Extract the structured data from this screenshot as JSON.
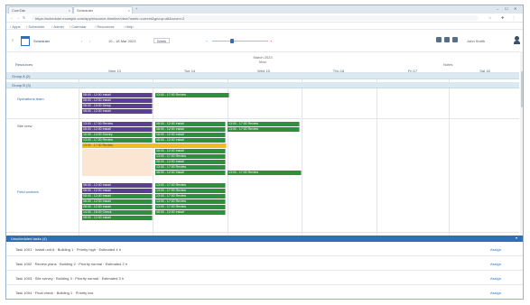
{
  "browser": {
    "tabs": [
      {
        "label": "ComTab"
      },
      {
        "label": "Scheduler"
      }
    ],
    "new_tab": "+",
    "url": "https://scheduler.example.com/app/resource-timeline/view?week=current&group=all&zoom=2",
    "bookmarks": [
      "Apps",
      "Scheduler",
      "Admin",
      "Calendar",
      "Resources",
      "Help"
    ],
    "window_controls": [
      "–",
      "☐",
      "✕"
    ]
  },
  "toolbar": {
    "app_title": "Scheduler",
    "prev": "‹",
    "next": "›",
    "date_range": "10 - 18 Mar 2023",
    "view": "Week",
    "zoom_minus": "−",
    "zoom_plus": "+",
    "user_name": "John Smith"
  },
  "header": {
    "resource_column": "Resources",
    "month": "March 2023",
    "weekday": "Mon",
    "columns": [
      "Mon 13",
      "Tue 14",
      "Wed 15",
      "Thu 16",
      "Fri 17",
      "Sat 18"
    ],
    "right_column": "Notes"
  },
  "groups": [
    {
      "label": "Group A (2)"
    },
    {
      "label": "Group B (3)"
    }
  ],
  "resources": [
    {
      "label": "Operations team"
    },
    {
      "label": "Site crew"
    },
    {
      "label": "Field workers"
    }
  ],
  "events": [
    {
      "text": "08:00 - 12:00 Install"
    },
    {
      "text": "08:00 - 12:00 Install"
    },
    {
      "text": "13:00 - 17:00 Review"
    },
    {
      "text": "08:00 - 10:00 Setup"
    },
    {
      "text": "08:00 - 12:00 Install"
    },
    {
      "text": "13:00 - 17:00 Review"
    },
    {
      "text": "08:00 - 12:00 Install"
    },
    {
      "text": "13:00 - 17:00 Review"
    },
    {
      "text": "08:00 - 12:00 Install"
    },
    {
      "text": "08:00 - 12:00 Install"
    },
    {
      "text": "13:00 - 17:00 Review"
    },
    {
      "text": "10:00 - 14:00 Survey"
    },
    {
      "text": "08:00 - 12:00 Install"
    },
    {
      "text": "13:00 - 17:00 Review"
    },
    {
      "text": "08:00 - 12:00 Install"
    },
    {
      "text": "13:00 - 17:00 Review"
    },
    {
      "text": "08:00 - 12:00 Install"
    },
    {
      "text": "13:00 - 17:00 Review"
    },
    {
      "text": "08:00 - 12:00 Install"
    },
    {
      "text": "13:00 - 17:00 Review"
    },
    {
      "text": "08:00 - 12:00 Install"
    },
    {
      "text": "13:00 - 17:00 Review"
    },
    {
      "text": "08:00 - 12:00 Install"
    },
    {
      "text": "13:00 - 17:00 Review"
    },
    {
      "text": "08:00 - 12:00 Install"
    },
    {
      "text": "13:00 - 17:00 Review"
    },
    {
      "text": "08:00 - 12:00 Install"
    },
    {
      "text": "13:00 - 17:00 Review"
    },
    {
      "text": "08:00 - 12:00 Install"
    },
    {
      "text": "13:00 - 17:00 Review"
    },
    {
      "text": "08:00 - 12:00 Install"
    },
    {
      "text": "13:00 - 17:00 Review"
    },
    {
      "text": "14:00 - 16:00 Check"
    },
    {
      "text": "08:00 - 12:00 Install"
    },
    {
      "text": "08:00 - 12:00 Install"
    }
  ],
  "panel": {
    "title": "Unscheduled tasks (4)",
    "toggle": "▾",
    "rows": [
      {
        "text": "Task 1001 · Install unit A · Building 1 · Priority high · Estimated 4 h",
        "link": "Assign"
      },
      {
        "text": "Task 1002 · Review plans · Building 2 · Priority normal · Estimated 2 h",
        "link": "Assign"
      },
      {
        "text": "Task 1003 · Site survey · Building 3 · Priority normal · Estimated 3 h",
        "link": "Assign"
      },
      {
        "text": "Task 1004 · Final check · Building 1 · Priority low",
        "link": "Assign"
      }
    ]
  },
  "colors": {
    "primary": "#2f6fb7",
    "event_purple": "#5a3f92",
    "event_green": "#2e8f3e",
    "event_yellow": "#f2bd1c",
    "group_band": "#dbe9f3"
  }
}
